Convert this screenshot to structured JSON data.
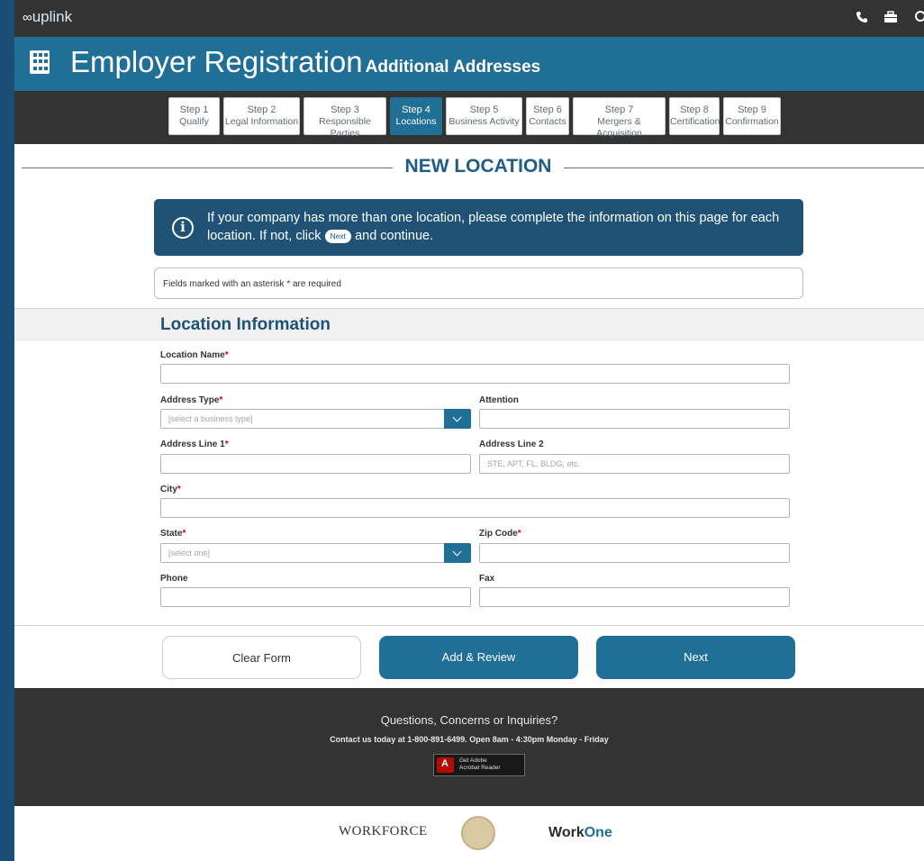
{
  "app": {
    "logo_mark": "∞",
    "logo_text": "uplink"
  },
  "header": {
    "title": "Employer Registration",
    "subtitle": "Additional Addresses"
  },
  "steps": [
    {
      "num": "Step 1",
      "label": "Qualify"
    },
    {
      "num": "Step 2",
      "label": "Legal Information"
    },
    {
      "num": "Step 3",
      "label": "Responsible Parties"
    },
    {
      "num": "Step 4",
      "label": "Locations"
    },
    {
      "num": "Step 5",
      "label": "Business Activity"
    },
    {
      "num": "Step 6",
      "label": "Contacts"
    },
    {
      "num": "Step 7",
      "label": "Mergers & Acquisition"
    },
    {
      "num": "Step 8",
      "label": "Certification"
    },
    {
      "num": "Step 9",
      "label": "Confirmation"
    }
  ],
  "active_step": "Step 4",
  "section_title": "NEW LOCATION",
  "info": {
    "text_before": "If your company has more than one location, please complete the information on this page for each location. If not, click",
    "pill": "Next",
    "text_after": "and continue."
  },
  "required_note": {
    "before": "Fields marked with an asterisk",
    "star": "*",
    "after": "are required"
  },
  "form": {
    "title": "Location Information",
    "location_name": {
      "label": "Location Name",
      "value": ""
    },
    "address_type": {
      "label": "Address Type",
      "placeholder": "[select a business type]"
    },
    "attention": {
      "label": "Attention",
      "value": ""
    },
    "address_line_1": {
      "label": "Address Line 1",
      "value": ""
    },
    "address_line_2": {
      "label": "Address Line 2",
      "placeholder": "STE, APT, FL, BLDG, etc."
    },
    "city": {
      "label": "City",
      "value": ""
    },
    "state": {
      "label": "State",
      "placeholder": "[select one]"
    },
    "zip": {
      "label": "Zip Code",
      "value": ""
    },
    "phone": {
      "label": "Phone",
      "value": ""
    },
    "fax": {
      "label": "Fax",
      "value": ""
    },
    "required_star": "*"
  },
  "buttons": {
    "clear": "Clear Form",
    "add_review": "Add & Review",
    "next": "Next"
  },
  "footer": {
    "question": "Questions, Concerns or Inquiries?",
    "contact": "Contact us today at 1-800-891-6499. Open 8am - 4:30pm Monday - Friday",
    "adobe_line1": "Get Adobe",
    "adobe_line2": "Acrobat Reader"
  },
  "logos": {
    "workforce": "WORKFORCE",
    "workone_a": "Work",
    "workone_b": "One"
  },
  "colors": {
    "accent": "#1f6f96",
    "dark": "#333333",
    "info_bg": "#1f5275",
    "required": "#d0021b"
  }
}
